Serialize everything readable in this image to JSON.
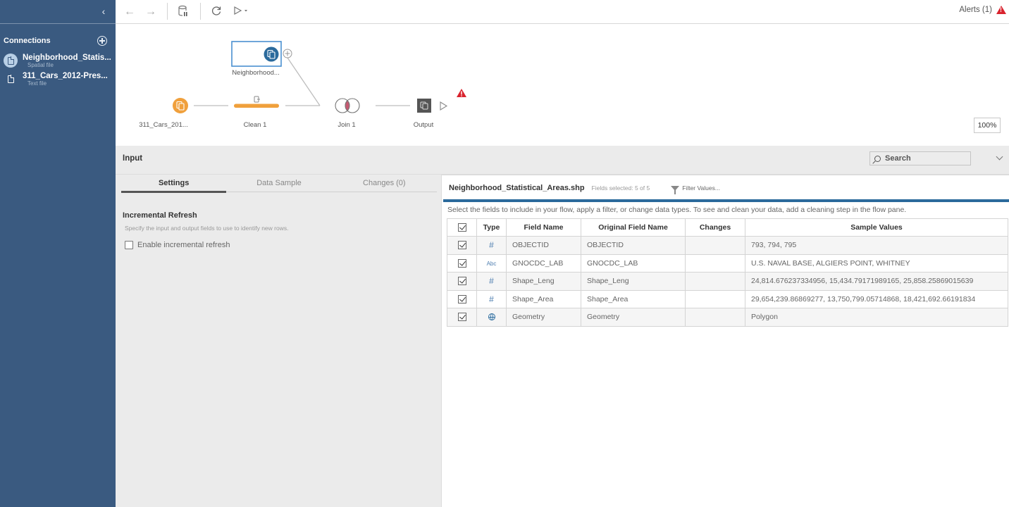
{
  "sidebar": {
    "collapse_icon": "chevron-left-icon",
    "connections_title": "Connections",
    "add_connection_icon": "plus-circle-icon",
    "connections": [
      {
        "name": "Neighborhood_Statis...",
        "type": "Spatial file",
        "icon": "document-icon",
        "selected": true
      },
      {
        "name": "311_Cars_2012-Pres...",
        "type": "Text file",
        "icon": "document-icon",
        "selected": false
      }
    ]
  },
  "toolbar": {
    "back_icon": "arrow-left-icon",
    "forward_icon": "arrow-right-icon",
    "pause_data_icon": "database-pause-icon",
    "refresh_icon": "refresh-icon",
    "run_icon": "play-icon",
    "run_dropdown_icon": "caret-down-icon",
    "alerts_label": "Alerts (1)",
    "alerts_icon": "warning-icon"
  },
  "flow": {
    "nodes": [
      {
        "id": "neighborhood",
        "label": "Neighborhood...",
        "kind": "input",
        "selected": true
      },
      {
        "id": "cars",
        "label": "311_Cars_201...",
        "kind": "input"
      },
      {
        "id": "clean1",
        "label": "Clean 1",
        "kind": "clean"
      },
      {
        "id": "join1",
        "label": "Join 1",
        "kind": "join"
      },
      {
        "id": "output",
        "label": "Output",
        "kind": "output"
      }
    ],
    "zoom_level": "100%",
    "colors": {
      "input_orange": "#f0a03c",
      "input_blue": "#2b6a9c",
      "join_fill": "#c55a72",
      "warning": "#d9232e"
    }
  },
  "panel": {
    "title": "Input",
    "search_placeholder": "Search",
    "tabs": [
      {
        "label": "Settings",
        "active": true
      },
      {
        "label": "Data Sample",
        "active": false
      },
      {
        "label": "Changes (0)",
        "active": false
      }
    ],
    "incremental": {
      "title": "Incremental Refresh",
      "description": "Specify the input and output fields to use to identify new rows.",
      "checkbox_label": "Enable incremental refresh",
      "checked": false
    },
    "fields_panel": {
      "file_name": "Neighborhood_Statistical_Areas.shp",
      "fields_selected": "Fields selected: 5 of 5",
      "filter_label": "Filter Values...",
      "description": "Select the fields to include in your flow, apply a filter, or change data types. To see and clean your data, add a cleaning step in the flow pane.",
      "columns": [
        "Type",
        "Field Name",
        "Original Field Name",
        "Changes",
        "Sample Values"
      ],
      "rows": [
        {
          "checked": true,
          "type": "number",
          "type_glyph": "#",
          "field": "OBJECTID",
          "original": "OBJECTID",
          "changes": "",
          "samples": "793, 794, 795"
        },
        {
          "checked": true,
          "type": "string",
          "type_glyph": "Abc",
          "field": "GNOCDC_LAB",
          "original": "GNOCDC_LAB",
          "changes": "",
          "samples": "U.S. NAVAL BASE, ALGIERS POINT, WHITNEY"
        },
        {
          "checked": true,
          "type": "number",
          "type_glyph": "#",
          "field": "Shape_Leng",
          "original": "Shape_Leng",
          "changes": "",
          "samples": "24,814.676237334956, 15,434.79171989165, 25,858.25869015639"
        },
        {
          "checked": true,
          "type": "number",
          "type_glyph": "#",
          "field": "Shape_Area",
          "original": "Shape_Area",
          "changes": "",
          "samples": "29,654,239.86869277, 13,750,799.05714868, 18,421,692.66191834"
        },
        {
          "checked": true,
          "type": "geometry",
          "type_glyph": "",
          "field": "Geometry",
          "original": "Geometry",
          "changes": "",
          "samples": "Polygon"
        }
      ]
    }
  }
}
